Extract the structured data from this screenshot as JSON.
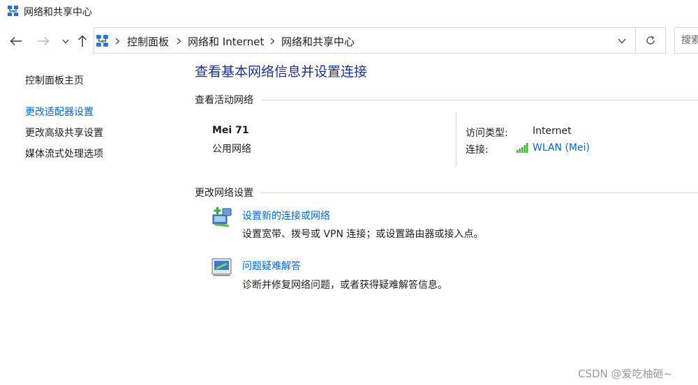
{
  "window": {
    "title": "网络和共享中心"
  },
  "nav": {
    "back_icon": "arrow-left-icon",
    "forward_icon": "arrow-right-icon",
    "recent_icon": "chevron-down-icon",
    "up_icon": "arrow-up-icon",
    "breadcrumbs": [
      "控制面板",
      "网络和 Internet",
      "网络和共享中心"
    ],
    "search_placeholder": "搜索"
  },
  "sidebar": {
    "items": [
      {
        "label": "控制面板主页"
      },
      {
        "label": "更改适配器设置"
      },
      {
        "label": "更改高级共享设置"
      },
      {
        "label": "媒体流式处理选项"
      }
    ]
  },
  "main": {
    "title": "查看基本网络信息并设置连接",
    "active_section": "查看活动网络",
    "network": {
      "name": "Mei 71",
      "type": "公用网络",
      "access_label": "访问类型:",
      "access_value": "Internet",
      "conn_label": "连接:",
      "conn_value": "WLAN (Mei)"
    },
    "change_section": "更改网络设置",
    "tasks": [
      {
        "link": "设置新的连接或网络",
        "desc": "设置宽带、拨号或 VPN 连接；或设置路由器或接入点。"
      },
      {
        "link": "问题疑难解答",
        "desc": "诊断并修复网络问题，或者获得疑难解答信息。"
      }
    ]
  },
  "watermark": "CSDN @爱吃柚砸~",
  "colors": {
    "link": "#0066cc",
    "title": "#1e3287",
    "signal": "#3cb43c"
  }
}
